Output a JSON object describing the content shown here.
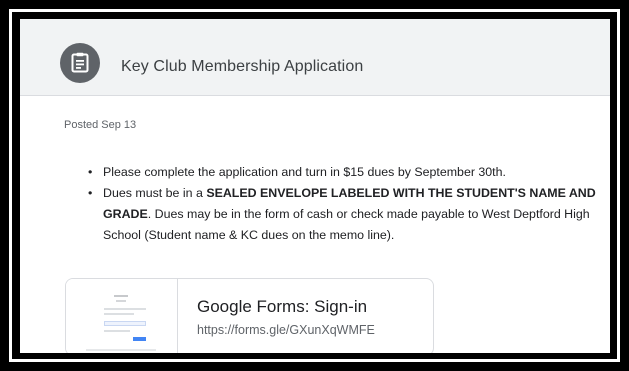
{
  "header": {
    "title": "Key Club Membership Application",
    "icon": "assignment-icon"
  },
  "post": {
    "posted": "Posted Sep 13",
    "bullets": [
      {
        "parts": [
          {
            "text": "Please complete the application and turn in $15 dues by September 30th.",
            "bold": false
          }
        ]
      },
      {
        "parts": [
          {
            "text": "Dues must be in a ",
            "bold": false
          },
          {
            "text": "SEALED ENVELOPE LABELED WITH THE STUDENT'S NAME AND GRADE",
            "bold": true
          },
          {
            "text": ". Dues may be in the form of cash or check made payable to West Deptford High School (Student name & KC dues on the memo line).",
            "bold": false
          }
        ]
      }
    ]
  },
  "attachment": {
    "title": "Google Forms: Sign-in",
    "url": "https://forms.gle/GXunXqWMFE"
  },
  "colors": {
    "header_bg": "#f1f3f4",
    "icon_bg": "#5f6368",
    "text": "#202124",
    "muted": "#5f6368",
    "border": "#dadce0"
  }
}
